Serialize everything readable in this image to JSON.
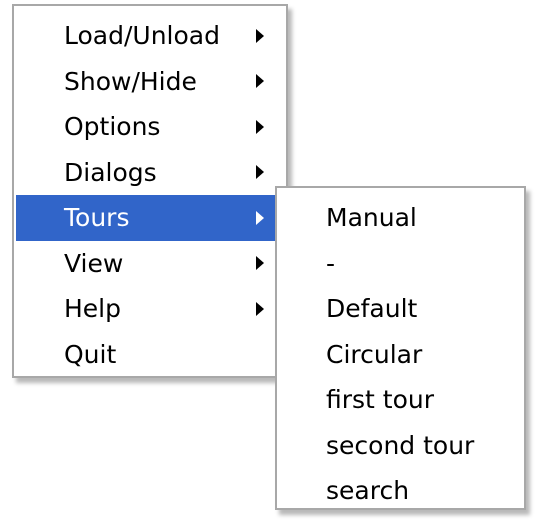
{
  "colors": {
    "highlight": "#3165c9",
    "highlight_text": "#ffffff",
    "menu_border": "#a8a8a8",
    "text": "#000000"
  },
  "main_menu": {
    "items": [
      {
        "label": "Load/Unload",
        "has_submenu": true,
        "highlighted": false,
        "arrow_icon": "triangle-right-icon"
      },
      {
        "label": "Show/Hide",
        "has_submenu": true,
        "highlighted": false,
        "arrow_icon": "triangle-right-icon"
      },
      {
        "label": "Options",
        "has_submenu": true,
        "highlighted": false,
        "arrow_icon": "triangle-right-icon"
      },
      {
        "label": "Dialogs",
        "has_submenu": true,
        "highlighted": false,
        "arrow_icon": "triangle-right-icon"
      },
      {
        "label": "Tours",
        "has_submenu": true,
        "highlighted": true,
        "arrow_icon": "triangle-right-icon"
      },
      {
        "label": "View",
        "has_submenu": true,
        "highlighted": false,
        "arrow_icon": "triangle-right-icon"
      },
      {
        "label": "Help",
        "has_submenu": true,
        "highlighted": false,
        "arrow_icon": "triangle-right-icon"
      },
      {
        "label": "Quit",
        "has_submenu": false,
        "highlighted": false
      }
    ]
  },
  "tours_submenu": {
    "items": [
      {
        "label": "Manual"
      },
      {
        "label": "-"
      },
      {
        "label": "Default"
      },
      {
        "label": "Circular"
      },
      {
        "label": "first tour"
      },
      {
        "label": "second tour"
      },
      {
        "label": "search"
      }
    ]
  }
}
